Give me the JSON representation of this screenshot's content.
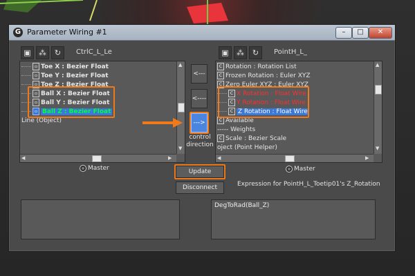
{
  "window": {
    "title": "Parameter Wiring #1"
  },
  "left": {
    "node_name": "CtrlC_L_Le",
    "rows": [
      {
        "label": "Toe X : Bezier Float",
        "style": "normal"
      },
      {
        "label": "Toe Y : Bezier Float",
        "style": "normal"
      },
      {
        "label": "Toe Z : Bezier Float",
        "style": "normal"
      },
      {
        "label": "Ball X : Bezier Float",
        "style": "normal"
      },
      {
        "label": "Ball Y : Bezier Float",
        "style": "normal"
      },
      {
        "label": "Ball Z : Bezier Float",
        "style": "selected-green"
      },
      {
        "label": "Line (Object)",
        "style": "plain"
      }
    ],
    "master_label": "Master"
  },
  "right": {
    "node_name": "PointH_L_",
    "rows": [
      {
        "label": "Rotation : Rotation List",
        "style": "plain"
      },
      {
        "label": "Frozen Rotation : Euler XYZ",
        "style": "plain"
      },
      {
        "label": "Zero Euler XYZ : Euler XYZ",
        "style": "plain"
      },
      {
        "label": "X Rotation : Float Wire",
        "style": "red"
      },
      {
        "label": "Y Rotation : Float Wire",
        "style": "red"
      },
      {
        "label": "Z Rotation : Float Wire",
        "style": "selected-blue"
      },
      {
        "label": "Available",
        "style": "plain"
      },
      {
        "label": "----- Weights",
        "style": "plain"
      },
      {
        "label": "Scale : Bezier Scale",
        "style": "plain"
      },
      {
        "label": "oject (Point Helper)",
        "style": "plain"
      }
    ],
    "master_label": "Master"
  },
  "center": {
    "btn_both": "<--->",
    "btn_left": "<----",
    "btn_right": "--->",
    "control_direction": "control\ndirection",
    "update_label": "Update",
    "disconnect_label": "Disconnect"
  },
  "expression": {
    "caption": "Expression for PointH_L_Toetip01's Z_Rotation",
    "left_text": "",
    "right_text": "DegToRad(Ball_Z)"
  },
  "icons": {
    "app": "gear-icon",
    "pick": "pick-object-icon",
    "hierarchy": "hierarchy-icon",
    "refresh": "refresh-icon"
  },
  "colors": {
    "highlight": "#f07a1a",
    "selection": "#3b78d8",
    "wire_red": "#ff3030",
    "wire_green": "#00ff40"
  }
}
